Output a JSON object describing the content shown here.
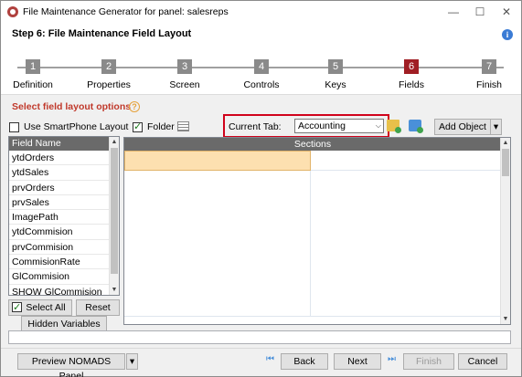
{
  "window": {
    "title": "File Maintenance Generator for panel: salesreps",
    "minimize": "—",
    "maximize": "☐",
    "close": "✕"
  },
  "header": {
    "step_title": "Step 6: File Maintenance Field Layout",
    "info_icon": "i"
  },
  "steps": [
    {
      "num": "1",
      "label": "Definition"
    },
    {
      "num": "2",
      "label": "Properties"
    },
    {
      "num": "3",
      "label": "Screen"
    },
    {
      "num": "4",
      "label": "Controls"
    },
    {
      "num": "5",
      "label": "Keys"
    },
    {
      "num": "6",
      "label": "Fields",
      "active": true
    },
    {
      "num": "7",
      "label": "Finish"
    }
  ],
  "section": {
    "title": "Select field layout options",
    "help_icon": "?"
  },
  "options": {
    "use_smartphone_label": "Use SmartPhone Layout",
    "use_smartphone_checked": false,
    "folder_label": "Folder",
    "folder_checked": true,
    "current_tab_label": "Current Tab:",
    "current_tab_value": "Accounting",
    "add_object_label": "Add Object",
    "dropdown_arrow": "▾"
  },
  "field_list": {
    "header": "Field Name",
    "items": [
      "ytdOrders",
      "ytdSales",
      "prvOrders",
      "prvSales",
      "ImagePath",
      "ytdCommision",
      "prvCommision",
      "CommisionRate",
      "GlCommision",
      "SHOW GlCommision"
    ]
  },
  "field_buttons": {
    "select_all": "Select All",
    "select_all_checked": true,
    "reset": "Reset",
    "hidden_variables": "Hidden Variables"
  },
  "sections_grid": {
    "header": "Sections"
  },
  "footer": {
    "preview_label": "Preview NOMADS Panel",
    "back_label": "Back",
    "next_label": "Next",
    "finish_label": "Finish",
    "cancel_label": "Cancel",
    "first_icon": "first-page-icon",
    "last_icon": "last-page-icon"
  },
  "colors": {
    "active_step": "#a01e24",
    "section_title": "#c0392b",
    "highlight_box": "#d0021b",
    "selected_cell": "#fde0b0"
  }
}
